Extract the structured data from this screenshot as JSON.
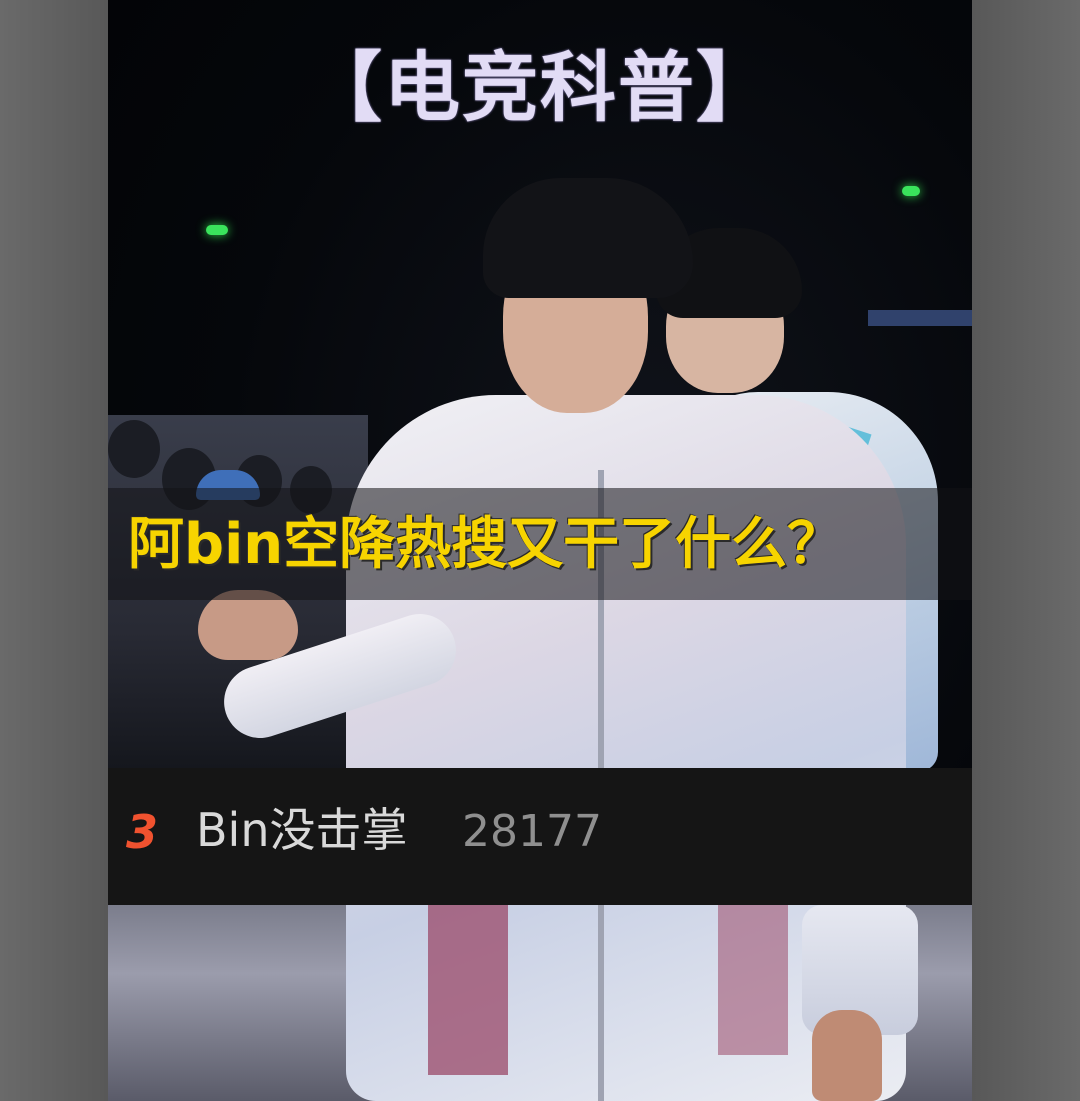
{
  "overlay": {
    "title": "【电竞科普】",
    "caption": "阿bin空降热搜又干了什么？"
  },
  "trending": {
    "rank": "3",
    "topic": "Bin没击掌",
    "count": "28177"
  },
  "colors": {
    "title": "#e2dcf5",
    "caption": "#f7d400",
    "rank": "#f0522f",
    "trend_background": "#151515"
  }
}
